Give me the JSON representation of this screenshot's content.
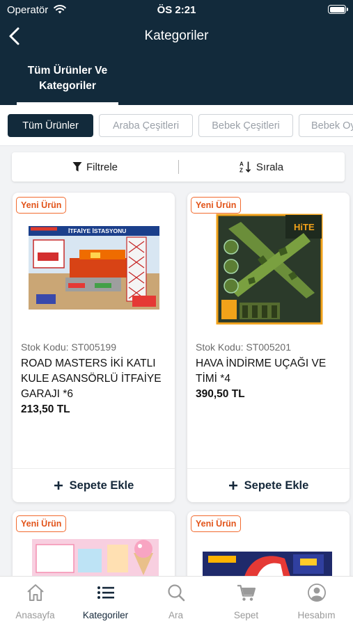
{
  "status_bar": {
    "carrier": "Operatör",
    "time": "ÖS 2:21"
  },
  "header": {
    "title": "Kategoriler",
    "tab_label": "Tüm Ürünler Ve Kategoriler"
  },
  "category_chips": [
    {
      "label": "Tüm Ürünler",
      "active": true
    },
    {
      "label": "Araba Çeşitleri",
      "active": false
    },
    {
      "label": "Bebek Çeşitleri",
      "active": false
    },
    {
      "label": "Bebek Oy",
      "active": false
    }
  ],
  "toolbar": {
    "filter_label": "Filtrele",
    "sort_label": "Sırala"
  },
  "products": [
    {
      "badge": "Yeni Ürün",
      "sku": "Stok Kodu: ST005199",
      "name": "ROAD MASTERS İKİ KATLI KULE ASANSÖRLÜ İTFAİYE GARAJI *6",
      "price": "213,50 TL",
      "add_to_cart": "Sepete Ekle",
      "image_text": "İTFAİYE İSTASYONU"
    },
    {
      "badge": "Yeni Ürün",
      "sku": "Stok Kodu: ST005201",
      "name": "HAVA İNDİRME UÇAĞI VE TİMİ *4",
      "price": "390,50 TL",
      "add_to_cart": "Sepete Ekle",
      "image_text": "HiTE"
    },
    {
      "badge": "Yeni Ürün"
    },
    {
      "badge": "Yeni Ürün"
    }
  ],
  "bottom_nav": [
    {
      "label": "Anasayfa",
      "icon": "home-icon",
      "active": false
    },
    {
      "label": "Kategoriler",
      "icon": "list-icon",
      "active": true
    },
    {
      "label": "Ara",
      "icon": "search-icon",
      "active": false
    },
    {
      "label": "Sepet",
      "icon": "cart-icon",
      "active": false
    },
    {
      "label": "Hesabım",
      "icon": "account-icon",
      "active": false
    }
  ],
  "colors": {
    "header_bg": "#122a3b",
    "badge": "#f26a2e",
    "accent_dark": "#15283a"
  }
}
